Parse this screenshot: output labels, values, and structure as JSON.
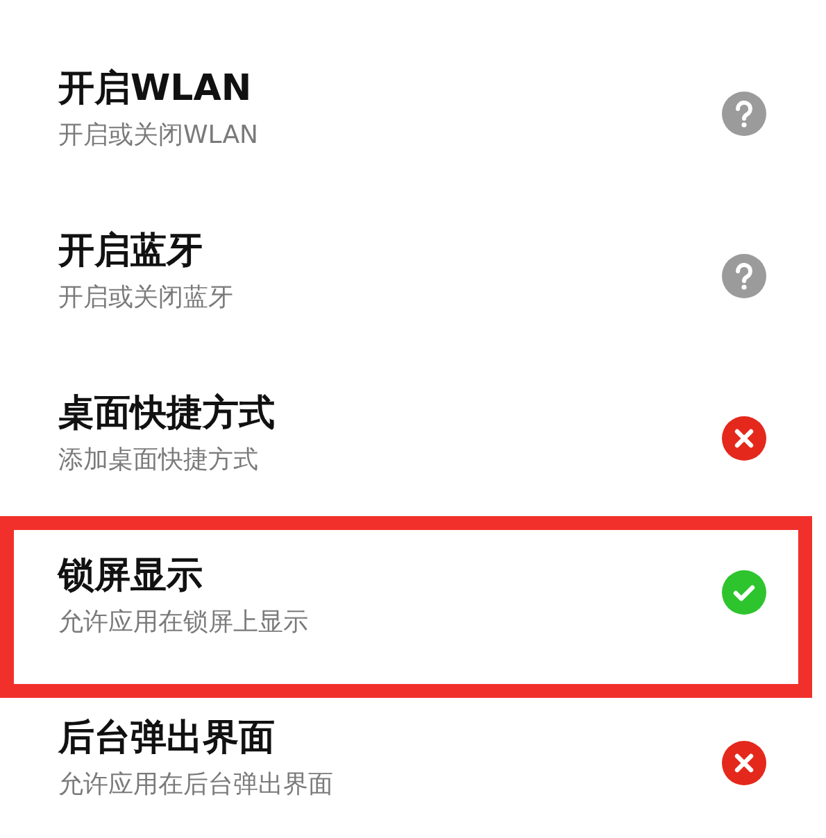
{
  "permissions": [
    {
      "title": "开启WLAN",
      "description": "开启或关闭WLAN",
      "kind": "unknown",
      "highlighted": false
    },
    {
      "title": "开启蓝牙",
      "description": "开启或关闭蓝牙",
      "kind": "unknown",
      "highlighted": false
    },
    {
      "title": "桌面快捷方式",
      "description": "添加桌面快捷方式",
      "kind": "denied",
      "highlighted": false
    },
    {
      "title": "锁屏显示",
      "description": "允许应用在锁屏上显示",
      "kind": "allowed",
      "highlighted": true
    },
    {
      "title": "后台弹出界面",
      "description": "允许应用在后台弹出界面",
      "kind": "denied",
      "highlighted": false
    }
  ]
}
